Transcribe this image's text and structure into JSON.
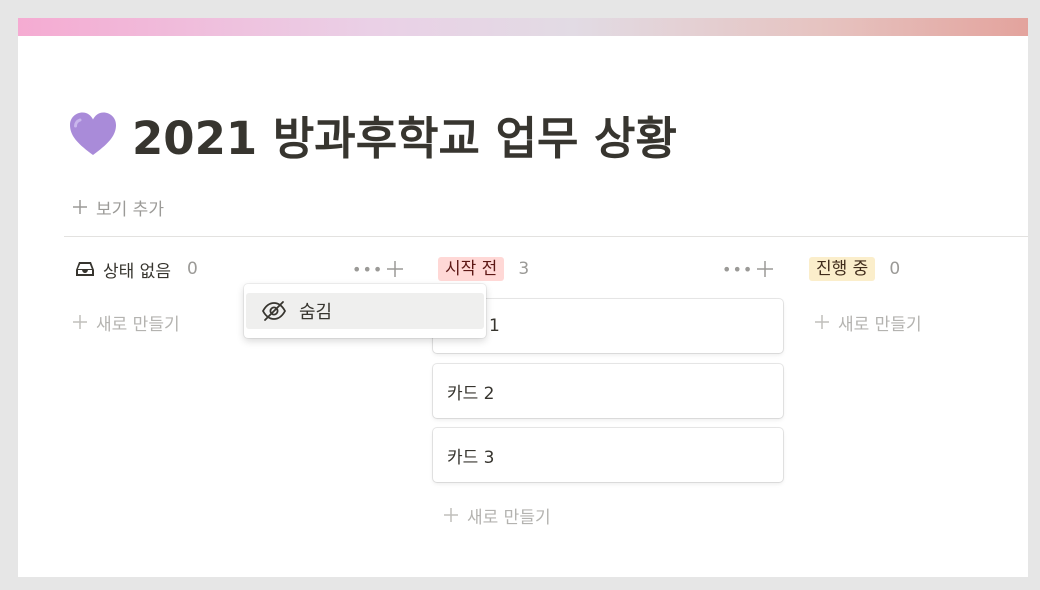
{
  "page": {
    "title": "2021 방과후학교 업무 상황",
    "icon": "purple-heart-icon",
    "add_view_label": "보기 추가"
  },
  "columns": [
    {
      "label": "상태 없음",
      "count": "0",
      "icon": "inbox-icon",
      "new_label": "새로 만들기"
    },
    {
      "label": "시작 전",
      "count": "3",
      "tag_color": "#ffd8d6",
      "new_label": "새로 만들기",
      "cards": [
        "1",
        "카드 2",
        "카드 3"
      ]
    },
    {
      "label": "진행 중",
      "count": "0",
      "tag_color": "#fbeecb",
      "new_label": "새로 만들기"
    }
  ],
  "context_menu": {
    "item_label": "숨김",
    "item_icon": "eye-off-icon"
  },
  "colors": {
    "text": "#37352f",
    "muted": "#9b9a97",
    "heart": "#a57fd8"
  }
}
